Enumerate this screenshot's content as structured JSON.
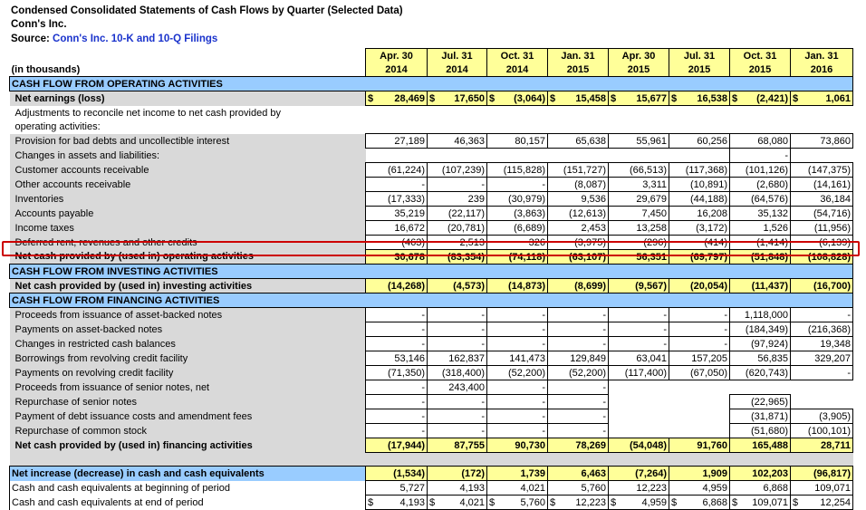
{
  "title": "Condensed Consolidated Statements of Cash Flows by Quarter (Selected Data)",
  "company": "Conn's Inc.",
  "source_label": "Source:",
  "source_link": "Conn's Inc. 10-K and 10-Q Filings",
  "units": "(in thousands)",
  "periods": [
    {
      "m": "Apr. 30",
      "y": "2014"
    },
    {
      "m": "Jul. 31",
      "y": "2014"
    },
    {
      "m": "Oct. 31",
      "y": "2014"
    },
    {
      "m": "Jan. 31",
      "y": "2015"
    },
    {
      "m": "Apr. 30",
      "y": "2015"
    },
    {
      "m": "Jul. 31",
      "y": "2015"
    },
    {
      "m": "Oct. 31",
      "y": "2015"
    },
    {
      "m": "Jan. 31",
      "y": "2016"
    }
  ],
  "rows": [
    {
      "type": "section",
      "label": "CASH FLOW FROM OPERATING ACTIVITIES"
    },
    {
      "type": "total",
      "label": "Net earnings (loss)",
      "dollar": true,
      "values": [
        "28,469",
        "17,650",
        "(3,064)",
        "15,458",
        "15,677",
        "16,538",
        "(2,421)",
        "1,061"
      ]
    },
    {
      "type": "note",
      "label": "Adjustments to reconcile net income to net cash provided by"
    },
    {
      "type": "note",
      "label": "operating activities:"
    },
    {
      "type": "gray",
      "indent": 1,
      "label": "Provision for bad debts and uncollectible interest",
      "values": [
        "27,189",
        "46,363",
        "80,157",
        "65,638",
        "55,961",
        "60,256",
        "68,080",
        "73,860"
      ]
    },
    {
      "type": "gray",
      "indent": 1,
      "label": "Changes in assets and liabilities:",
      "values": [
        "",
        "",
        "",
        "",
        "",
        "",
        "-",
        ""
      ]
    },
    {
      "type": "gray",
      "indent": 2,
      "label": "Customer accounts receivable",
      "values": [
        "(61,224)",
        "(107,239)",
        "(115,828)",
        "(151,727)",
        "(66,513)",
        "(117,368)",
        "(101,126)",
        "(147,375)"
      ]
    },
    {
      "type": "gray",
      "indent": 2,
      "label": "Other accounts receivable",
      "values": [
        "-",
        "-",
        "-",
        "(8,087)",
        "3,311",
        "(10,891)",
        "(2,680)",
        "(14,161)"
      ]
    },
    {
      "type": "gray",
      "indent": 2,
      "label": "Inventories",
      "values": [
        "(17,333)",
        "239",
        "(30,979)",
        "9,536",
        "29,679",
        "(44,188)",
        "(64,576)",
        "36,184"
      ]
    },
    {
      "type": "gray",
      "indent": 2,
      "label": "Accounts payable",
      "values": [
        "35,219",
        "(22,117)",
        "(3,863)",
        "(12,613)",
        "7,450",
        "16,208",
        "35,132",
        "(54,716)"
      ]
    },
    {
      "type": "gray",
      "indent": 2,
      "label": "Income taxes",
      "values": [
        "16,672",
        "(20,781)",
        "(6,689)",
        "2,453",
        "13,258",
        "(3,172)",
        "1,526",
        "(11,956)"
      ]
    },
    {
      "type": "gray",
      "indent": 2,
      "label": "Deferred rent, revenues and other credits",
      "values": [
        "(463)",
        "2,513",
        "326",
        "(3,975)",
        "(296)",
        "(414)",
        "(1,414)",
        "(6,139)"
      ]
    },
    {
      "type": "total",
      "indent": 1,
      "label": "Net cash provided by (used in) operating activities",
      "values": [
        "30,678",
        "(83,354)",
        "(74,118)",
        "(63,107)",
        "56,351",
        "(69,797)",
        "(51,848)",
        "(108,828)"
      ]
    },
    {
      "type": "section",
      "label": "CASH FLOW FROM INVESTING ACTIVITIES"
    },
    {
      "type": "total",
      "indent": 1,
      "label": "Net cash provided by (used in) investing activities",
      "values": [
        "(14,268)",
        "(4,573)",
        "(14,873)",
        "(8,699)",
        "(9,567)",
        "(20,054)",
        "(11,437)",
        "(16,700)"
      ]
    },
    {
      "type": "section",
      "label": "CASH FLOW FROM FINANCING ACTIVITIES"
    },
    {
      "type": "gray",
      "indent": 0,
      "label": "Proceeds from issuance of asset-backed notes",
      "values": [
        "-",
        "-",
        "-",
        "-",
        "-",
        "-",
        "1,118,000",
        "-"
      ]
    },
    {
      "type": "gray",
      "indent": 0,
      "label": "Payments on asset-backed notes",
      "values": [
        "-",
        "-",
        "-",
        "-",
        "-",
        "-",
        "(184,349)",
        "(216,368)"
      ]
    },
    {
      "type": "gray",
      "indent": 0,
      "label": "Changes in restricted cash balances",
      "values": [
        "-",
        "-",
        "-",
        "-",
        "-",
        "-",
        "(97,924)",
        "19,348"
      ]
    },
    {
      "type": "gray",
      "indent": 0,
      "label": "Borrowings from revolving credit facility",
      "values": [
        "53,146",
        "162,837",
        "141,473",
        "129,849",
        "63,041",
        "157,205",
        "56,835",
        "329,207"
      ]
    },
    {
      "type": "gray",
      "indent": 0,
      "label": "Payments on revolving credit facility",
      "values": [
        "(71,350)",
        "(318,400)",
        "(52,200)",
        "(52,200)",
        "(117,400)",
        "(67,050)",
        "(620,743)",
        "-"
      ]
    },
    {
      "type": "gray",
      "indent": 0,
      "label": "Proceeds from issuance of senior notes, net",
      "values": [
        "-",
        "243,400",
        "-",
        "-",
        "",
        "",
        "",
        ""
      ]
    },
    {
      "type": "gray",
      "indent": 0,
      "label": "Repurchase of senior notes",
      "values": [
        "-",
        "-",
        "-",
        "-",
        "",
        "",
        "(22,965)",
        ""
      ]
    },
    {
      "type": "gray",
      "indent": 0,
      "label": "Payment of debt issuance costs and amendment fees",
      "values": [
        "-",
        "-",
        "-",
        "-",
        "",
        "",
        "(31,871)",
        "(3,905)"
      ]
    },
    {
      "type": "gray",
      "indent": 0,
      "label": "Repurchase of common stock",
      "values": [
        "-",
        "-",
        "-",
        "-",
        "",
        "",
        "(51,680)",
        "(100,101)"
      ]
    },
    {
      "type": "total",
      "indent": 3,
      "label": "Net cash provided by (used in) financing activities",
      "values": [
        "(17,944)",
        "87,755",
        "90,730",
        "78,269",
        "(54,048)",
        "91,760",
        "165,488",
        "28,711"
      ]
    },
    {
      "type": "spacer"
    },
    {
      "type": "netinc",
      "label": "Net increase (decrease) in cash and cash equivalents",
      "values": [
        "(1,534)",
        "(172)",
        "1,739",
        "6,463",
        "(7,264)",
        "1,909",
        "102,203",
        "(96,817)"
      ]
    },
    {
      "type": "plain",
      "label": "Cash and cash equivalents at beginning of period",
      "values": [
        "5,727",
        "4,193",
        "4,021",
        "5,760",
        "12,223",
        "4,959",
        "6,868",
        "109,071"
      ]
    },
    {
      "type": "plain",
      "label": "Cash and cash equivalents at end of period",
      "dollar": true,
      "values": [
        "4,193",
        "4,021",
        "5,760",
        "12,223",
        "4,959",
        "6,868",
        "109,071",
        "12,254"
      ]
    }
  ],
  "dollar_sign": "$"
}
